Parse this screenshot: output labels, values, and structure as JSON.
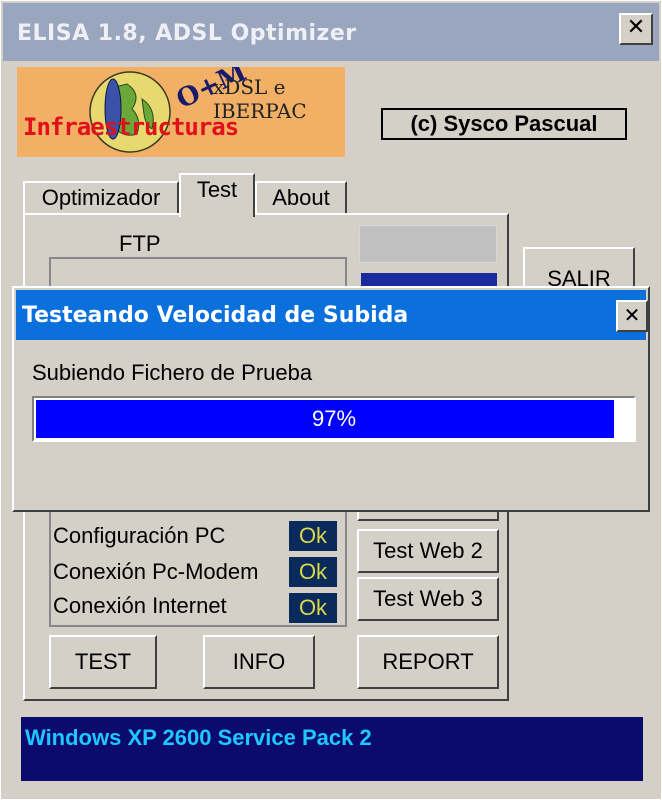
{
  "window": {
    "title": "ELISA 1.8,  ADSL Optimizer",
    "close_symbol": "✕"
  },
  "logo": {
    "om": "O+M",
    "xdsl": "xDSL e",
    "iberpac": "IBERPAC",
    "infra": "Infraestructuras"
  },
  "copyright": "(c) Sysco Pascual",
  "tabs": [
    {
      "label": "Optimizador"
    },
    {
      "label": "Test"
    },
    {
      "label": "About"
    }
  ],
  "active_tab": "Test",
  "panel": {
    "ftp_label": "FTP",
    "salir_label": "SALIR",
    "status_items": [
      {
        "label": "Configuración PC",
        "value": "Ok"
      },
      {
        "label": "Conexión Pc-Modem",
        "value": "Ok"
      },
      {
        "label": "Conexión Internet",
        "value": "Ok"
      }
    ],
    "web_buttons": [
      {
        "label": "Test Web 2"
      },
      {
        "label": "Test Web 3"
      }
    ],
    "bottom_buttons": [
      {
        "label": "TEST"
      },
      {
        "label": "INFO"
      },
      {
        "label": "REPORT"
      }
    ]
  },
  "status_bar": {
    "text": "Windows XP 2600 Service Pack 2"
  },
  "dialog": {
    "title": "Testeando Velocidad de Subida",
    "close_symbol": "✕",
    "message": "Subiendo Fichero de Prueba",
    "progress": {
      "percent": 97,
      "label": "97%"
    }
  },
  "colors": {
    "title_bar": "#9aa6bd",
    "dialog_title_bar": "#0b6fdc",
    "progress_fill": "#0000ff",
    "status_bar_bg": "#0b0b6e",
    "status_bar_text": "#1ec8ff",
    "ok_badge_bg": "#0a2a5c",
    "ok_badge_text": "#d8d84a",
    "logo_bg": "#f2b066",
    "logo_text": "#e0101a"
  }
}
